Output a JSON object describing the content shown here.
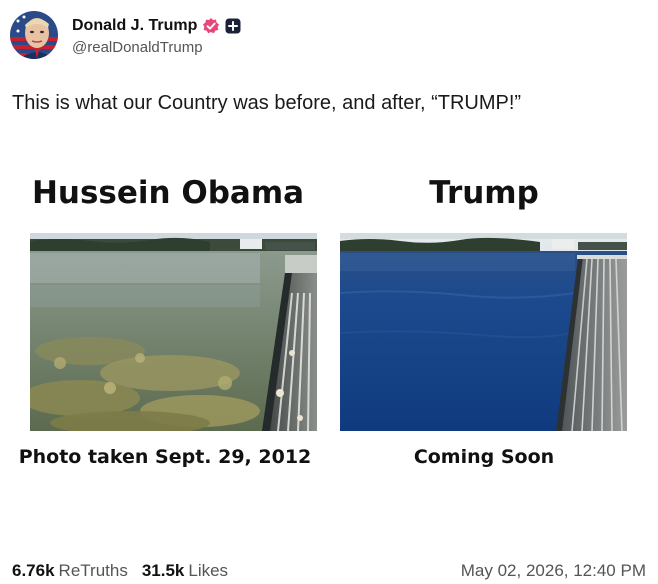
{
  "post": {
    "author": {
      "display_name": "Donald J. Trump",
      "handle": "@realDonaldTrump",
      "verified_icon": "verified-badge-icon",
      "plus_icon": "plus-badge-icon",
      "verified_color": "#e8477a"
    },
    "text": "This is what our Country was before, and after, “TRUMP!”",
    "image": {
      "left": {
        "title": "Hussein Obama",
        "caption": "Photo taken Sept. 29, 2012"
      },
      "right": {
        "title": "Trump",
        "caption": "Coming Soon"
      }
    },
    "stats": {
      "retruths_count": "6.76k",
      "retruths_label": "ReTruths",
      "likes_count": "31.5k",
      "likes_label": "Likes"
    },
    "timestamp": "May 02, 2026, 12:40 PM"
  }
}
